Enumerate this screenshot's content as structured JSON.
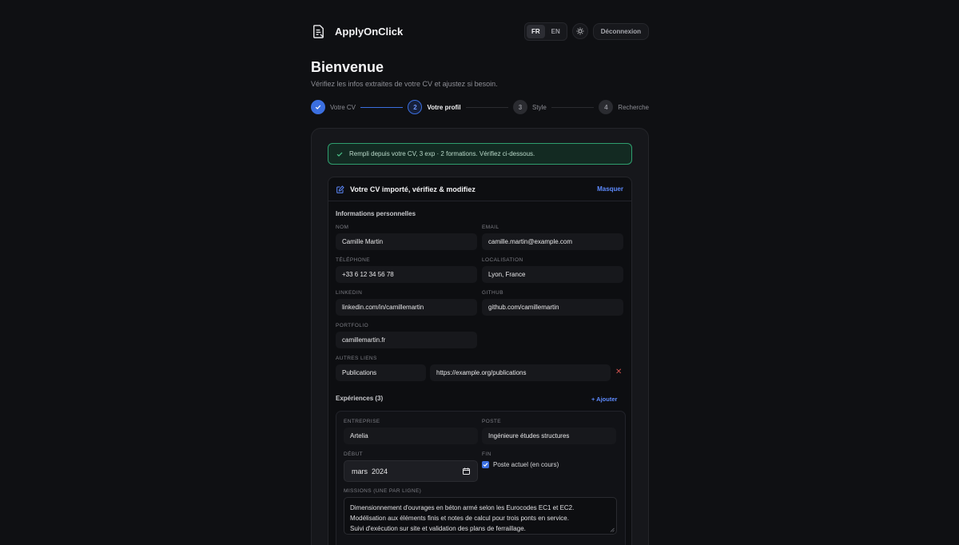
{
  "app": {
    "name": "ApplyOnClick"
  },
  "header": {
    "lang_fr": "FR",
    "lang_en": "EN",
    "theme_icon": "sun-icon",
    "logout_label": "Déconnexion"
  },
  "page": {
    "title": "Bienvenue",
    "subtitle": "Vérifiez les infos extraites de votre CV et ajustez si besoin."
  },
  "stepper": {
    "steps": [
      {
        "number": "1",
        "label": "Votre CV",
        "state": "done"
      },
      {
        "number": "2",
        "label": "Votre profil",
        "state": "current"
      },
      {
        "number": "3",
        "label": "Style",
        "state": "todo"
      },
      {
        "number": "4",
        "label": "Recherche",
        "state": "todo"
      }
    ]
  },
  "banner": {
    "text": "Rempli depuis votre CV, 3 exp · 2 formations. Vérifiez ci-dessous."
  },
  "panel": {
    "title": "Votre CV importé, vérifiez & modifiez",
    "toggle_label": "Masquer"
  },
  "personal": {
    "section_title": "Informations personnelles",
    "nom_label": "NOM",
    "nom_value": "Camille Martin",
    "email_label": "EMAIL",
    "email_value": "camille.martin@example.com",
    "tel_label": "TÉLÉPHONE",
    "tel_value": "+33 6 12 34 56 78",
    "loc_label": "LOCALISATION",
    "loc_value": "Lyon, France",
    "linkedin_label": "LINKEDIN",
    "linkedin_value": "linkedin.com/in/camillemartin",
    "github_label": "GITHUB",
    "github_value": "github.com/camillemartin",
    "portfolio_label": "PORTFOLIO",
    "portfolio_value": "camillemartin.fr",
    "other_links_label": "AUTRES LIENS",
    "other_link_name": "Publications",
    "other_link_url": "https://example.org/publications"
  },
  "experiences": {
    "section_title": "Expériences (3)",
    "add_label": "+ Ajouter",
    "first": {
      "company_label": "ENTREPRISE",
      "company_value": "Artelia",
      "position_label": "POSTE",
      "position_value": "Ingénieure études structures",
      "start_label": "DÉBUT",
      "start_value": "mars  2024",
      "end_label": "FIN",
      "current_label": "Poste actuel (en cours)",
      "current_checked": true,
      "missions_label": "MISSIONS (UNE PAR LIGNE)",
      "missions": [
        "Dimensionnement d'ouvrages en béton armé selon les Eurocodes EC1 et EC2.",
        "Modélisation aux éléments finis et notes de calcul pour trois ponts en service.",
        "Suivi d'exécution sur site et validation des plans de ferraillage."
      ]
    }
  },
  "colors": {
    "accent": "#3b6fe0",
    "link": "#5e8bff",
    "success_border": "#2f9e6e",
    "danger": "#d0524e"
  }
}
